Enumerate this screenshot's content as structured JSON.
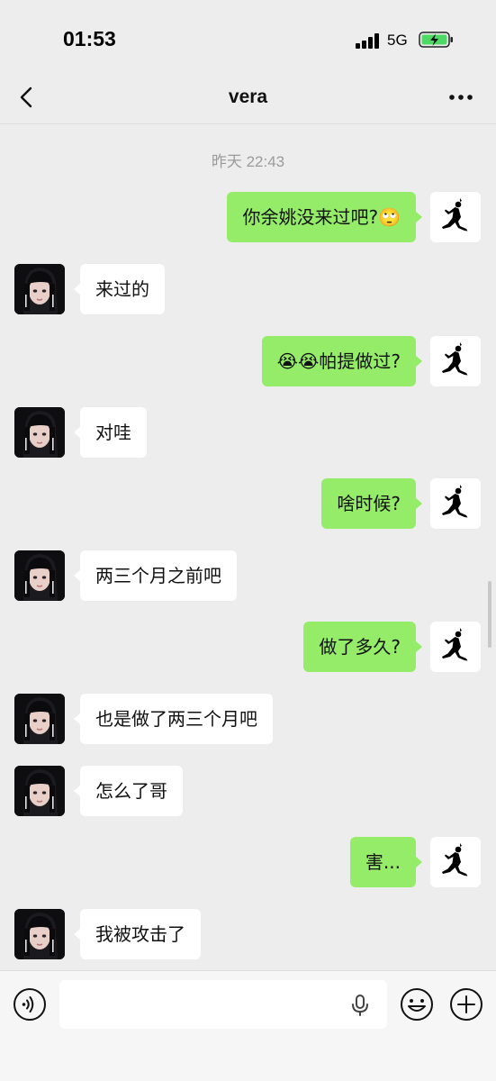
{
  "status_bar": {
    "time": "01:53",
    "network": "5G"
  },
  "header": {
    "title": "vera"
  },
  "chat": {
    "timestamp": "昨天 22:43",
    "messages": [
      {
        "side": "right",
        "text": "你余姚没来过吧?🙄"
      },
      {
        "side": "left",
        "text": "来过的"
      },
      {
        "side": "right",
        "text": "😭😭帕提做过?"
      },
      {
        "side": "left",
        "text": "对哇"
      },
      {
        "side": "right",
        "text": "啥时候?"
      },
      {
        "side": "left",
        "text": "两三个月之前吧"
      },
      {
        "side": "right",
        "text": "做了多久?"
      },
      {
        "side": "left",
        "text": "也是做了两三个月吧"
      },
      {
        "side": "left",
        "text": "怎么了哥"
      },
      {
        "side": "right",
        "text": "害..."
      },
      {
        "side": "left",
        "text": "我被攻击了"
      }
    ]
  },
  "input_bar": {
    "placeholder": ""
  },
  "colors": {
    "sent_bubble": "#95ec69",
    "received_bubble": "#ffffff",
    "background": "#ededed"
  },
  "icons": {
    "back": "chevron-left-icon",
    "more": "more-dots-icon",
    "voice": "voice-icon",
    "mic": "mic-icon",
    "emoji": "emoji-icon",
    "plus": "plus-icon",
    "sender_avatar": "jumpman-logo-avatar",
    "contact_avatar": "girl-portrait-avatar"
  }
}
